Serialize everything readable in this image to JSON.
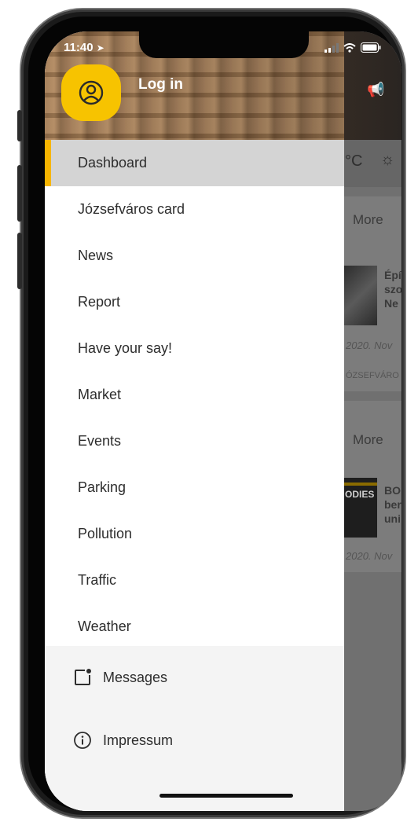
{
  "status": {
    "time": "11:40"
  },
  "header": {
    "login_label": "Log in"
  },
  "menu": {
    "items": [
      {
        "label": "Dashboard"
      },
      {
        "label": "Józsefváros card"
      },
      {
        "label": "News"
      },
      {
        "label": "Report"
      },
      {
        "label": "Have your say!"
      },
      {
        "label": "Market"
      },
      {
        "label": "Events"
      },
      {
        "label": "Parking"
      },
      {
        "label": "Pollution"
      },
      {
        "label": "Traffic"
      },
      {
        "label": "Weather"
      }
    ]
  },
  "footer": {
    "messages_label": "Messages",
    "impressum_label": "Impressum"
  },
  "background": {
    "temp_unit": "°C",
    "card1": {
      "more": "More",
      "title_lines": [
        "Épí",
        "szo",
        "Ne"
      ],
      "date": "2020. Nov",
      "source": "ÓZSEFVÁRO"
    },
    "card2": {
      "more": "More",
      "title_lines": [
        "BO",
        "ber",
        "uni"
      ],
      "date": "2020. Nov",
      "thumb_text": "ODIES"
    }
  },
  "colors": {
    "accent": "#f7c300",
    "active_bar": "#f7b500",
    "active_bg": "#d4d4d4"
  }
}
